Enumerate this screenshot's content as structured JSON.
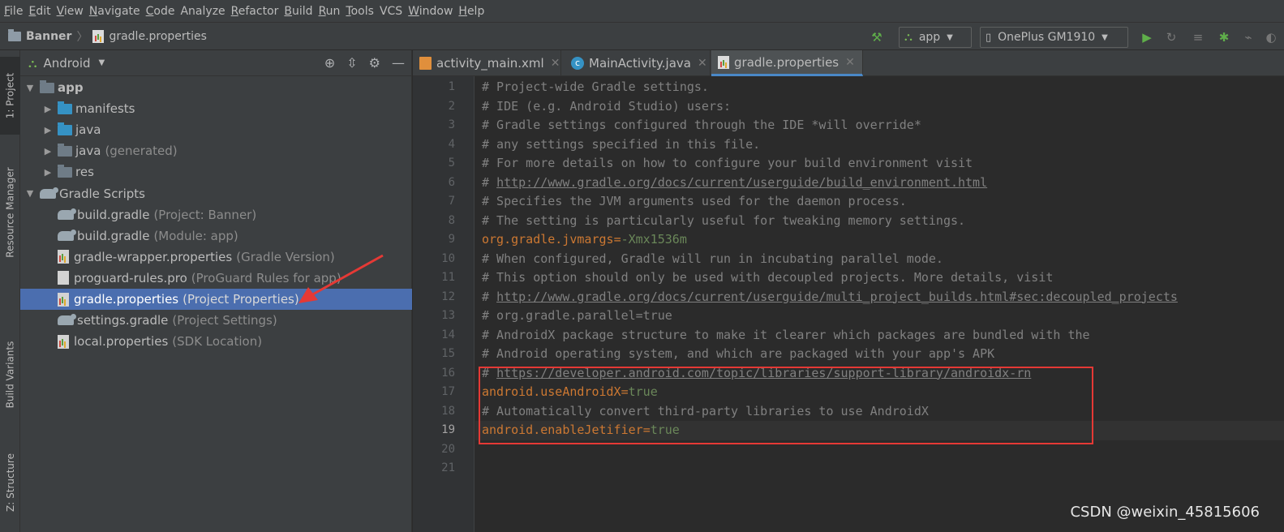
{
  "menu": [
    {
      "mnemonic": "F",
      "rest": "ile"
    },
    {
      "mnemonic": "E",
      "rest": "dit"
    },
    {
      "mnemonic": "V",
      "rest": "iew"
    },
    {
      "mnemonic": "N",
      "rest": "avigate"
    },
    {
      "mnemonic": "C",
      "rest": "ode"
    },
    {
      "mnemonic": "",
      "rest": "Analyze"
    },
    {
      "mnemonic": "R",
      "rest": "efactor"
    },
    {
      "mnemonic": "B",
      "rest": "uild"
    },
    {
      "mnemonic": "R",
      "rest": "un"
    },
    {
      "mnemonic": "T",
      "rest": "ools"
    },
    {
      "mnemonic": "",
      "rest": "VCS"
    },
    {
      "mnemonic": "W",
      "rest": "indow"
    },
    {
      "mnemonic": "H",
      "rest": "elp"
    }
  ],
  "breadcrumb": {
    "project": "Banner",
    "file": "gradle.properties"
  },
  "toolbar": {
    "config": "app",
    "device": "OnePlus GM1910"
  },
  "toolstrip": {
    "project": "1: Project",
    "resource": "Resource Manager",
    "variants": "Build Variants",
    "structure": "Z: Structure"
  },
  "project_panel": {
    "view": "Android",
    "rows": [
      {
        "label": "app",
        "suffix": ""
      },
      {
        "label": "manifests",
        "suffix": ""
      },
      {
        "label": "java",
        "suffix": ""
      },
      {
        "label": "java",
        "suffix": "(generated)"
      },
      {
        "label": "res",
        "suffix": ""
      },
      {
        "label": "Gradle Scripts",
        "suffix": ""
      },
      {
        "label": "build.gradle",
        "suffix": "(Project: Banner)"
      },
      {
        "label": "build.gradle",
        "suffix": "(Module: app)"
      },
      {
        "label": "gradle-wrapper.properties",
        "suffix": "(Gradle Version)"
      },
      {
        "label": "proguard-rules.pro",
        "suffix": "(ProGuard Rules for app)"
      },
      {
        "label": "gradle.properties",
        "suffix": "(Project Properties)"
      },
      {
        "label": "settings.gradle",
        "suffix": "(Project Settings)"
      },
      {
        "label": "local.properties",
        "suffix": "(SDK Location)"
      }
    ]
  },
  "tabs": [
    {
      "label": "activity_main.xml"
    },
    {
      "label": "MainActivity.java"
    },
    {
      "label": "gradle.properties"
    }
  ],
  "lines": [
    {
      "n": "1",
      "c": "# Project-wide Gradle settings."
    },
    {
      "n": "2",
      "c": "# IDE (e.g. Android Studio) users:"
    },
    {
      "n": "3",
      "c": "# Gradle settings configured through the IDE *will override*"
    },
    {
      "n": "4",
      "c": "# any settings specified in this file."
    },
    {
      "n": "5",
      "c": "# For more details on how to configure your build environment visit"
    },
    {
      "n": "6",
      "p": "# ",
      "link": "http://www.gradle.org/docs/current/userguide/build_environment.html"
    },
    {
      "n": "7",
      "c": "# Specifies the JVM arguments used for the daemon process."
    },
    {
      "n": "8",
      "c": "# The setting is particularly useful for tweaking memory settings."
    },
    {
      "n": "9",
      "k": "org.gradle.jvmargs",
      "v": "-Xmx1536m"
    },
    {
      "n": "10",
      "c": "# When configured, Gradle will run in incubating parallel mode."
    },
    {
      "n": "11",
      "c": "# This option should only be used with decoupled projects. More details, visit"
    },
    {
      "n": "12",
      "p": "# ",
      "link": "http://www.gradle.org/docs/current/userguide/multi_project_builds.html#sec:decoupled_projects"
    },
    {
      "n": "13",
      "c": "# org.gradle.parallel=true"
    },
    {
      "n": "14",
      "c": "# AndroidX package structure to make it clearer which packages are bundled with the"
    },
    {
      "n": "15",
      "c": "# Android operating system, and which are packaged with your app's APK"
    },
    {
      "n": "16",
      "p": "# ",
      "link": "https://developer.android.com/topic/libraries/support-library/androidx-rn"
    },
    {
      "n": "17",
      "k": "android.useAndroidX",
      "v": "true"
    },
    {
      "n": "18",
      "c": "# Automatically convert third-party libraries to use AndroidX"
    },
    {
      "n": "19",
      "k": "android.enableJetifier",
      "v": "true"
    },
    {
      "n": "20",
      "c": ""
    },
    {
      "n": "21",
      "c": ""
    }
  ],
  "eq": "=",
  "watermark": "CSDN @weixin_45815606",
  "colors": {
    "selection": "#4b6eaf",
    "keyword": "#cc7832",
    "comment": "#808080",
    "string": "#6a8759",
    "annotation": "#e53935"
  }
}
